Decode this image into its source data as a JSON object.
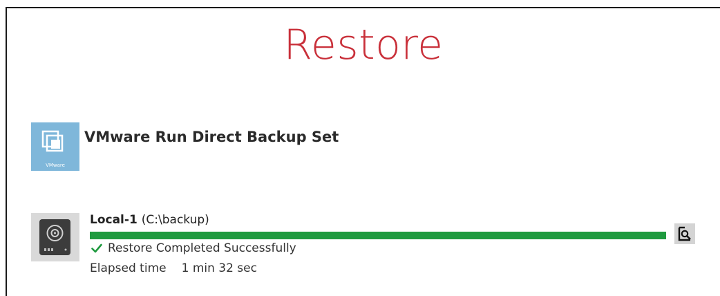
{
  "page": {
    "title": "Restore",
    "title_color": "#c9303a"
  },
  "backup_set": {
    "name": "VMware Run Direct Backup Set",
    "icon": "vmware-icon",
    "icon_caption": "VMware",
    "icon_color": "#7fb7da"
  },
  "destination": {
    "name": "Local-1",
    "path": "(C:\\backup)",
    "icon": "hard-drive-icon",
    "progress": 1.0,
    "progress_color": "#1f9a3f",
    "status_icon": "check-icon",
    "status_text": "Restore Completed Successfully",
    "elapsed_label": "Elapsed time",
    "elapsed_value": "1 min 32 sec",
    "view_log_icon": "magnify-log-icon"
  }
}
